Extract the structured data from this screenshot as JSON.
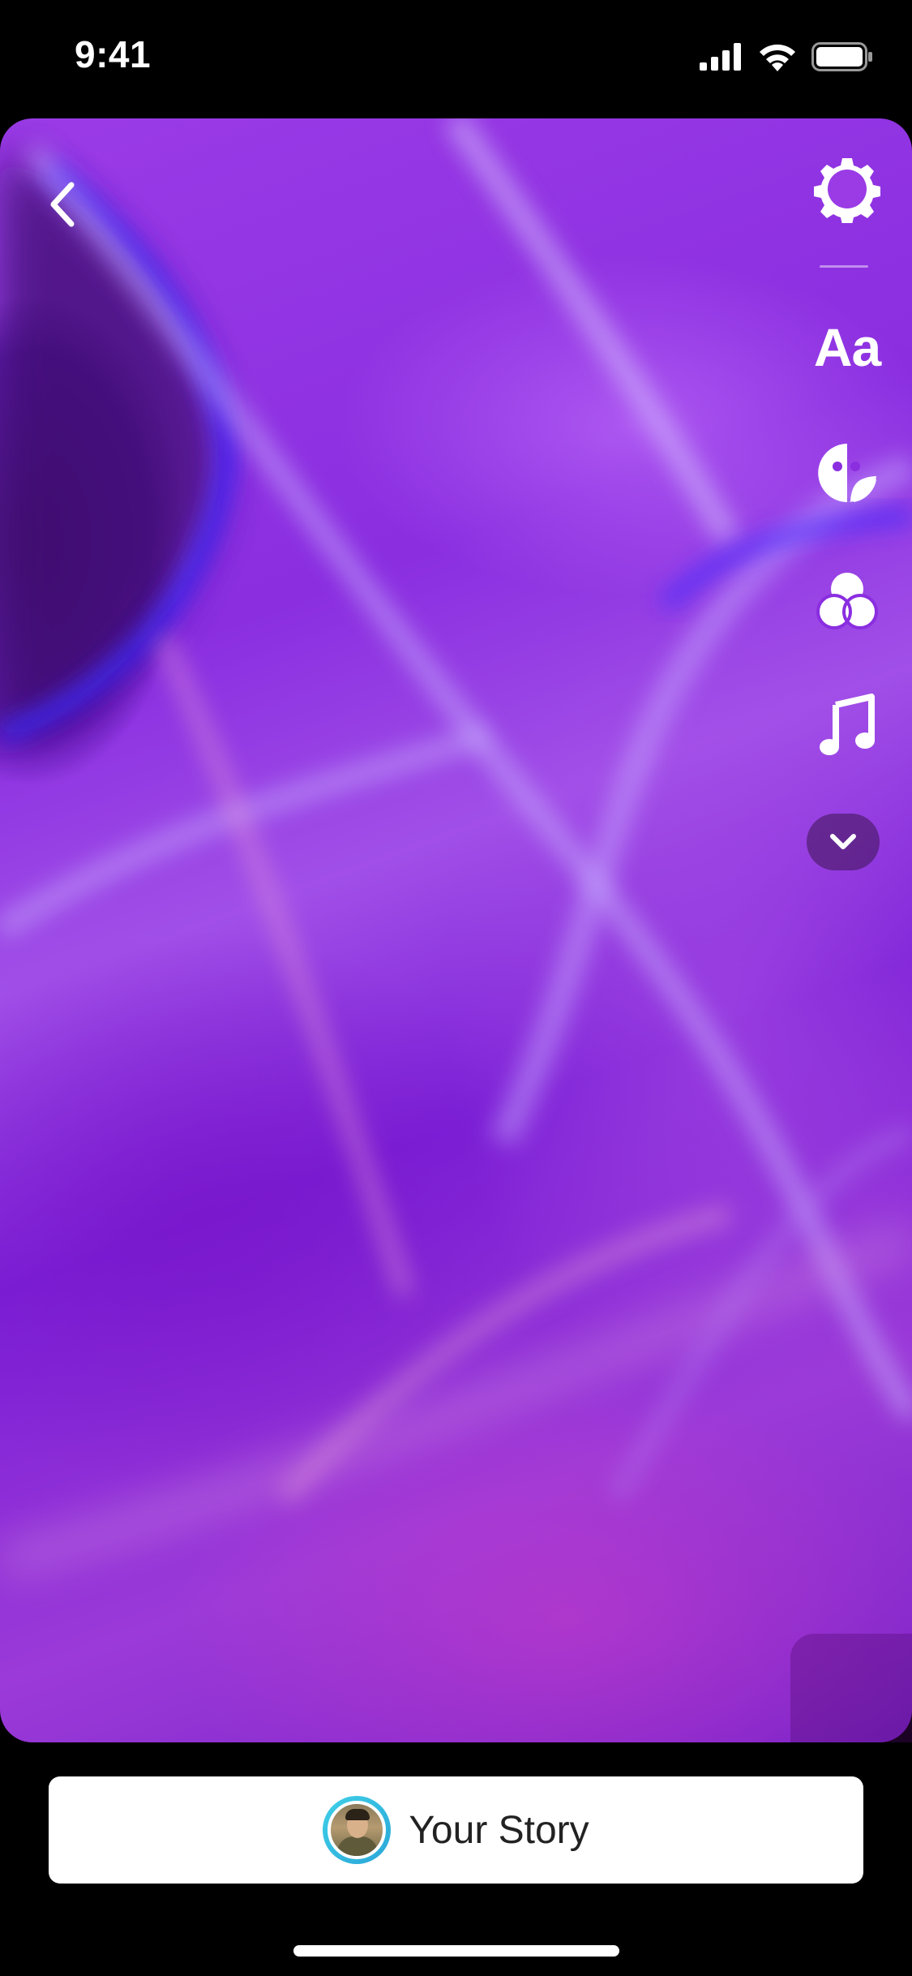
{
  "status_bar": {
    "time": "9:41",
    "icons": [
      "cellular-signal-icon",
      "wifi-icon",
      "battery-icon"
    ]
  },
  "editor": {
    "back_icon": "chevron-left-icon",
    "tools": [
      {
        "name": "settings",
        "icon": "gear-icon"
      },
      {
        "name": "text",
        "label": "Aa"
      },
      {
        "name": "stickers",
        "icon": "sticker-icon"
      },
      {
        "name": "effects",
        "icon": "effects-icon"
      },
      {
        "name": "music",
        "icon": "music-note-icon"
      },
      {
        "name": "more",
        "icon": "chevron-down-icon"
      }
    ]
  },
  "share": {
    "your_story_label": "Your Story"
  },
  "colors": {
    "background": "#000000",
    "canvas_purple": "#8a2ee0",
    "story_ring": "#3fd0e8",
    "button_bg": "#ffffff"
  }
}
